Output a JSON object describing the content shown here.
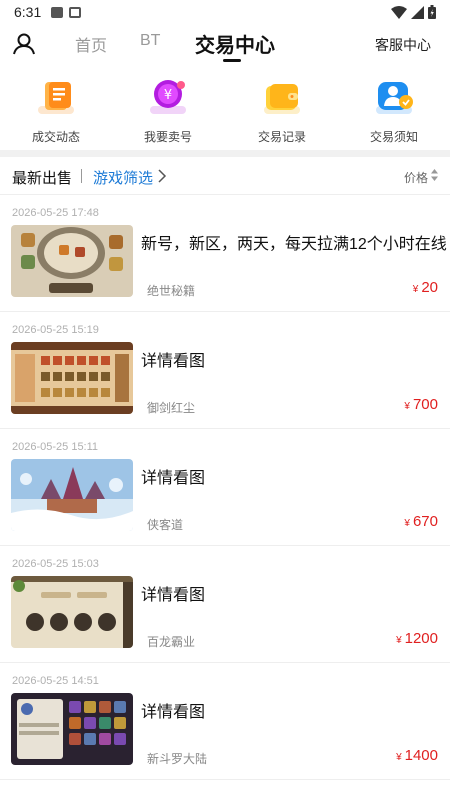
{
  "status": {
    "time": "6:31"
  },
  "nav": {
    "tabs": [
      "首页",
      "BT",
      "交易中心"
    ],
    "service": "客服中心"
  },
  "quick": [
    {
      "label": "成交动态",
      "icon": "deal-news-icon",
      "color": "#ff8c1a"
    },
    {
      "label": "我要卖号",
      "icon": "sell-account-icon",
      "color": "#b31de0"
    },
    {
      "label": "交易记录",
      "icon": "trade-record-icon",
      "color": "#ffb51a"
    },
    {
      "label": "交易须知",
      "icon": "trade-notice-icon",
      "color": "#1e8ef0"
    }
  ],
  "filter": {
    "latest": "最新出售",
    "game_filter": "游戏筛选",
    "price": "价格"
  },
  "currency": "¥",
  "listings": [
    {
      "date": "2026-05-25 17:48",
      "title": "新号，新区，两天，每天拉满12个小时在线",
      "game": "绝世秘籍",
      "price": "20"
    },
    {
      "date": "2026-05-25 15:19",
      "title": "详情看图",
      "game": "御剑红尘",
      "price": "700"
    },
    {
      "date": "2026-05-25 15:11",
      "title": "详情看图",
      "game": "侠客道",
      "price": "670"
    },
    {
      "date": "2026-05-25 15:03",
      "title": "详情看图",
      "game": "百龙霸业",
      "price": "1200"
    },
    {
      "date": "2026-05-25 14:51",
      "title": "详情看图",
      "game": "新斗罗大陆",
      "price": "1400"
    }
  ],
  "colors": {
    "accent": "#1e7bd6",
    "price": "#e02020"
  }
}
